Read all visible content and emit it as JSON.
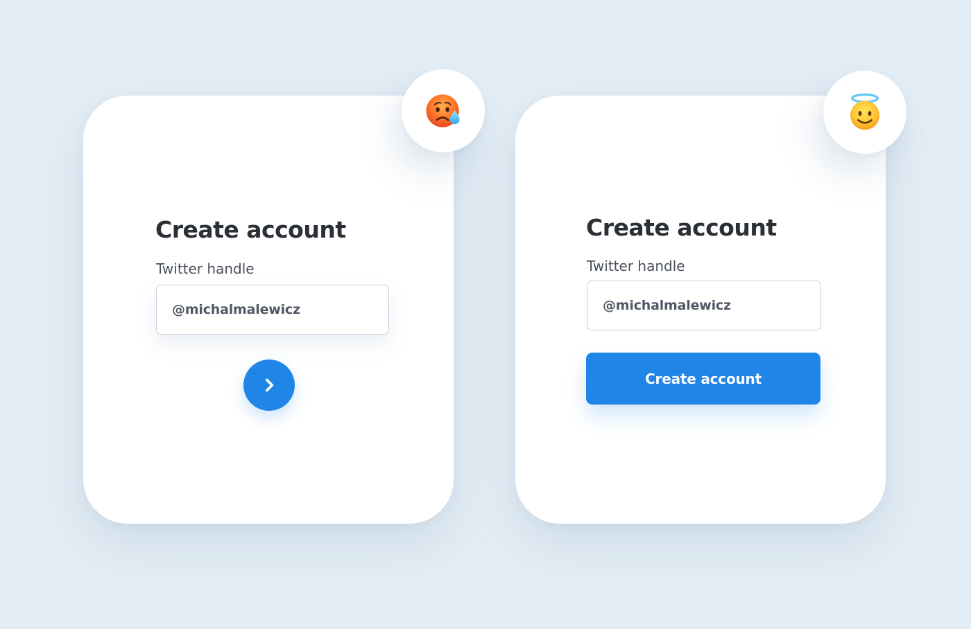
{
  "cards": [
    {
      "emoji": "sad-sweat-emoji-icon",
      "title": "Create account",
      "field_label": "Twitter handle",
      "field_value": "@michalmalewicz",
      "action_icon": "chevron-right-icon"
    },
    {
      "emoji": "halo-smile-emoji-icon",
      "title": "Create account",
      "field_label": "Twitter handle",
      "field_value": "@michalmalewicz",
      "action_label": "Create account"
    }
  ],
  "colors": {
    "background": "#e3edf5",
    "card": "#ffffff",
    "accent": "#1f85e6",
    "title": "#2b2f36",
    "label": "#4a505b",
    "input_border": "#c9cfdf",
    "input_text": "#515866"
  }
}
